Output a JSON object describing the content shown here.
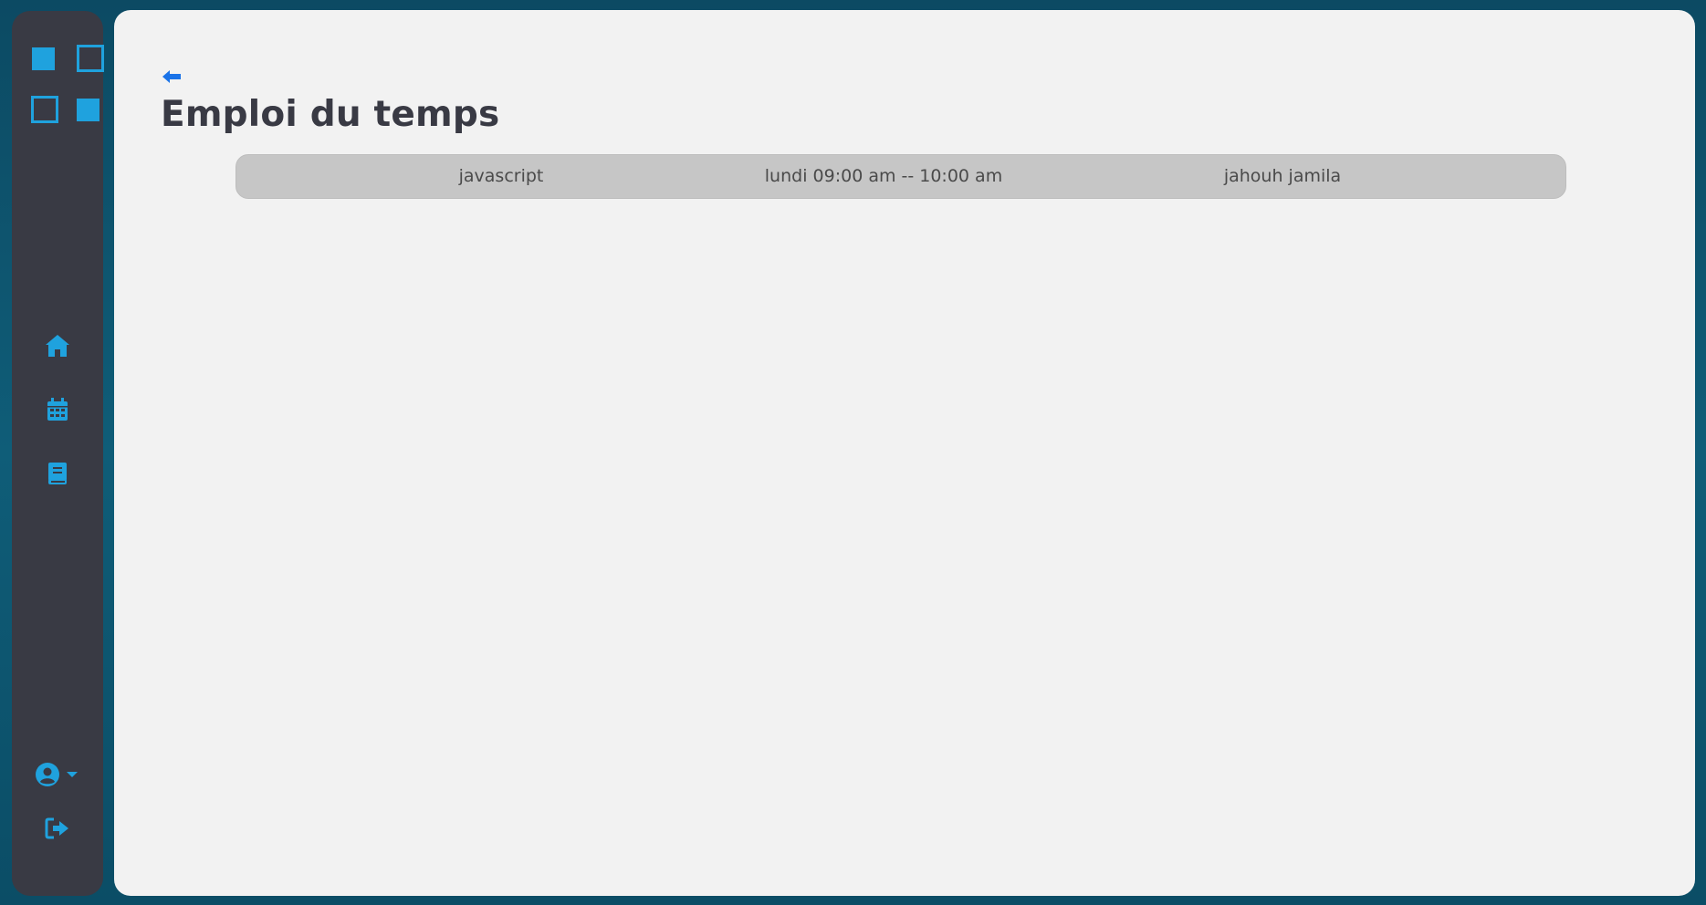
{
  "page": {
    "title": "Emploi du temps"
  },
  "sidebar": {
    "logo_icon": "logo-squares-icon",
    "nav_items": [
      {
        "name": "home",
        "icon": "home-icon"
      },
      {
        "name": "schedule",
        "icon": "calendar-icon"
      },
      {
        "name": "courses",
        "icon": "book-icon"
      }
    ],
    "user_icon": "user-circle-icon",
    "user_menu_icon": "caret-down-icon",
    "logout_icon": "logout-icon"
  },
  "schedule": {
    "rows": [
      {
        "subject": "javascript",
        "time": "lundi 09:00 am -- 10:00 am",
        "teacher": "jahouh jamila"
      }
    ]
  },
  "colors": {
    "accent": "#1fa2de",
    "back_arrow": "#1a73e8",
    "sidebar_bg": "#393a44",
    "main_bg": "#f2f2f2",
    "row_bg": "#c6c6c6",
    "title": "#393a44"
  }
}
